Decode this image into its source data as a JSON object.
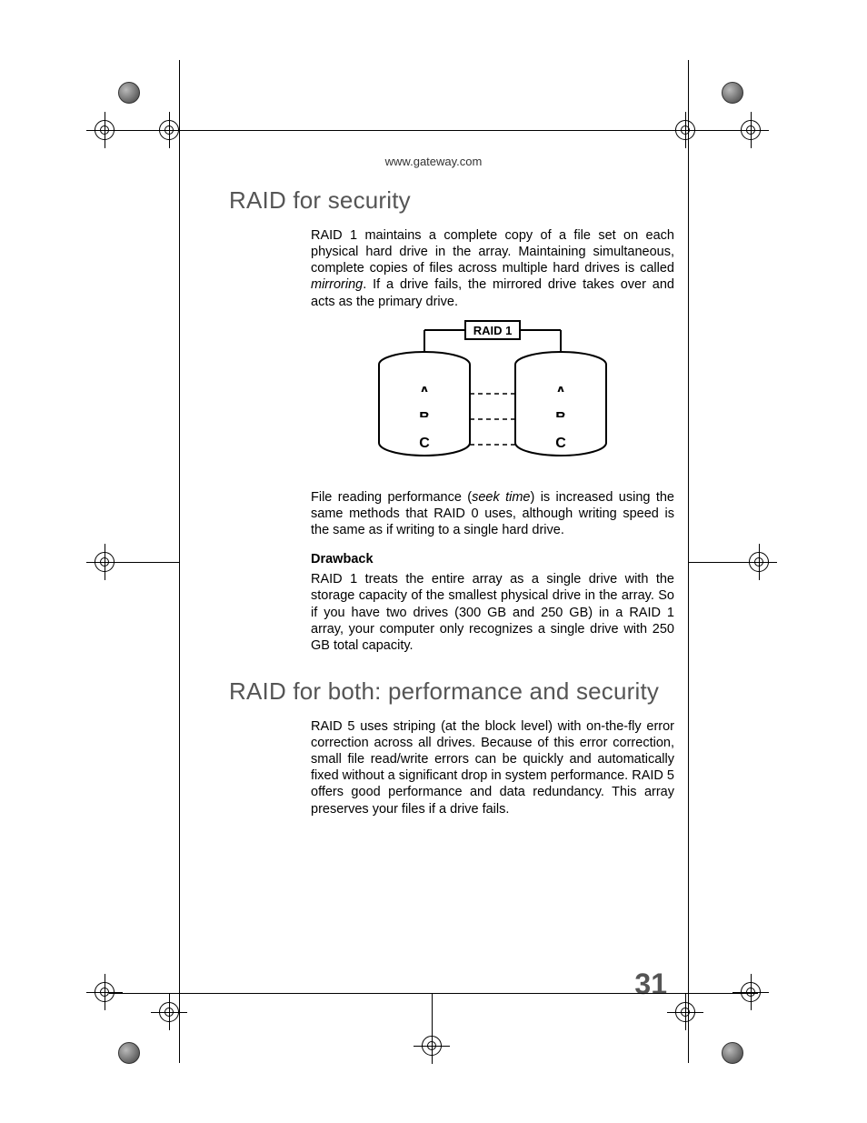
{
  "header": {
    "url": "www.gateway.com"
  },
  "section1": {
    "title": "RAID for security",
    "para1a": "RAID 1 maintains a complete copy of a file set on each physical hard drive in the array. Maintaining simultaneous, complete copies of files across multiple hard drives is called ",
    "para1b_italic": "mirroring",
    "para1c": ". If a drive fails, the mirrored drive takes over and acts as the primary drive.",
    "para2a": "File reading performance (",
    "para2b_italic": "seek time",
    "para2c": ") is increased using the same methods that RAID 0 uses, although writing speed is the same as if writing to a single hard drive.",
    "subhead": "Drawback",
    "para3": "RAID 1 treats the entire array as a single drive with the storage capacity of the smallest physical drive in the array. So if you have two drives (300 GB and 250 GB) in a RAID 1 array, your computer only recognizes a single drive with 250 GB total capacity."
  },
  "diagram": {
    "label": "RAID 1",
    "drive1": {
      "plat1": "A",
      "plat2": "B",
      "plat3": "C"
    },
    "drive2": {
      "plat1": "A",
      "plat2": "B",
      "plat3": "C"
    }
  },
  "section2": {
    "title": "RAID for both: performance and security",
    "para1": "RAID 5 uses striping (at the block level) with on-the-fly error correction across all drives. Because of this error correction, small file read/write errors can be quickly and automatically fixed without a significant drop in system performance. RAID 5 offers good performance and data redundancy. This array preserves your files if a drive fails."
  },
  "page_number": "31"
}
